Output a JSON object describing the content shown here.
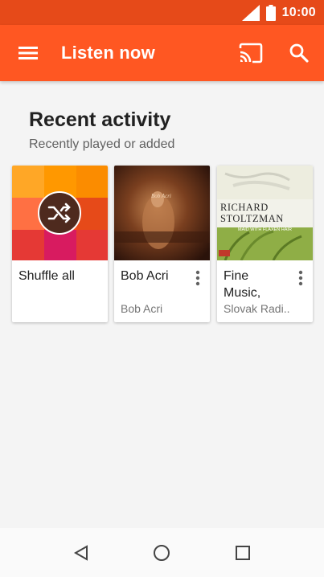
{
  "status_bar": {
    "time": "10:00",
    "icons": [
      "signal-icon",
      "battery-icon"
    ]
  },
  "app_bar": {
    "title": "Listen now",
    "icons": [
      "menu-icon",
      "cast-icon",
      "search-icon"
    ]
  },
  "recent": {
    "title": "Recent activity",
    "subtitle": "Recently played or added",
    "cards": [
      {
        "title": "Shuffle all",
        "subtitle": "",
        "art": "shuffle-icon"
      },
      {
        "title": "Bob Acri",
        "subtitle": "Bob Acri",
        "art_text": "Bob Acri"
      },
      {
        "title": "Fine Music,",
        "subtitle": "Slovak Radi..",
        "art_text_1": "RICHARD",
        "art_text_2": "STOLTZMAN",
        "art_text_3": "MAID WITH FLAXEN HAIR"
      }
    ]
  },
  "nav_bar": {
    "icons": [
      "back-icon",
      "home-icon",
      "recents-icon"
    ]
  },
  "colors": {
    "status_bar": "#e64a19",
    "app_bar": "#ff5722",
    "background": "#f4f4f4"
  }
}
